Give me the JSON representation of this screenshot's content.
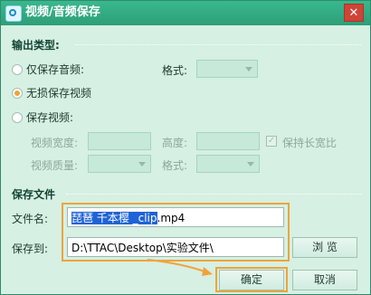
{
  "window": {
    "title": "视频/音频保存",
    "close_glyph": "✕"
  },
  "output_type": {
    "heading": "输出类型:",
    "option_audio_only": "仅保存音频:",
    "audio_format_label": "格式:",
    "option_lossless": "无损保存视频",
    "option_video": "保存视频:",
    "selected": "无损保存视频",
    "video_width_label": "视频宽度:",
    "height_label": "高度:",
    "keep_ratio_label": "保持长宽比",
    "video_quality_label": "视频质量:",
    "video_format_label": "格式:"
  },
  "save_file": {
    "heading": "保存文件",
    "filename_label": "文件名:",
    "filename_selected": "琵琶 千本樱 _clip",
    "filename_rest": ".mp4",
    "save_to_label": "保存到:",
    "save_to_value": "D:\\TTAC\\Desktop\\实验文件\\",
    "browse_label": "浏 览"
  },
  "buttons": {
    "ok": "确定",
    "cancel": "取消"
  },
  "colors": {
    "accent": "#f0a33a",
    "titlebar": "#2e9e79",
    "background": "#d6f0e3"
  }
}
